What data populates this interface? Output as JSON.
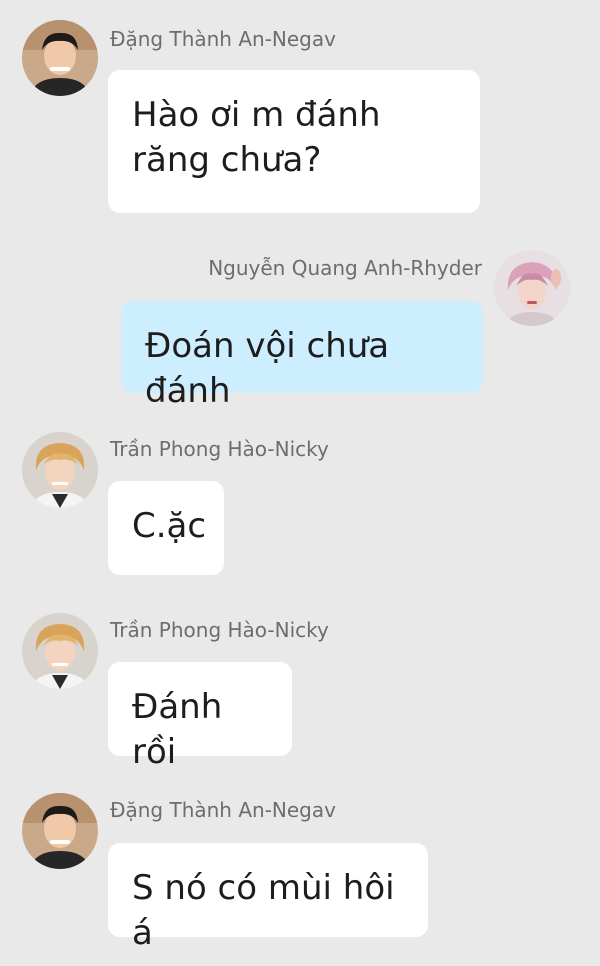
{
  "messages": [
    {
      "sender": "Đặng Thành An-Negav",
      "text": "Hào ơi m đánh\nrăng chưa?",
      "avatar": "male-portrait-avatar-dark-hair"
    },
    {
      "sender": "Nguyễn Quang Anh-Rhyder",
      "text": "Đoán vội chưa đánh",
      "avatar": "male-portrait-avatar-pink-hair"
    },
    {
      "sender": "Trần Phong Hào-Nicky",
      "text": "C.ặc",
      "avatar": "male-portrait-avatar-blond-hair"
    },
    {
      "sender": "Trần Phong Hào-Nicky",
      "text": "Đánh rồi",
      "avatar": "male-portrait-avatar-blond-hair"
    },
    {
      "sender": "Đặng Thành An-Negav",
      "text": "S nó có mùi hôi á",
      "avatar": "male-portrait-avatar-dark-hair"
    }
  ],
  "colors": {
    "background": "#e9e9e9",
    "bubble_incoming": "#ffffff",
    "bubble_outgoing": "#cdeeff",
    "sender_text": "#6d6d6d",
    "message_text": "#1d1d1d"
  }
}
